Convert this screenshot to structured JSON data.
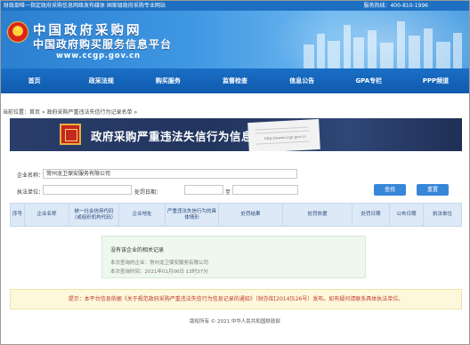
{
  "topbar": {
    "left_text": "财政部唯一指定政府采购信息网络发布媒体 国家级政府采购专业网站",
    "hotline": "服务热线：400-810-1996"
  },
  "header": {
    "site_title": "中国政府采购网",
    "site_subtitle": "中国政府购买服务信息平台",
    "url": "www.ccgp.gov.cn"
  },
  "nav": {
    "items": [
      "首页",
      "政采法规",
      "购买服务",
      "监督检查",
      "信息公告",
      "GPA专栏",
      "PPP频道"
    ]
  },
  "breadcrumb": {
    "prefix": "当前位置：",
    "home": "首页",
    "sep1": " » ",
    "section": "政府采购严重违法失信行为记录名单",
    "sep2": " » "
  },
  "page_title": {
    "text": "政府采购严重违法失信行为信息记录",
    "paper_url": "http://www.ccgp.gov.cn"
  },
  "search": {
    "company_label": "企业名称：",
    "company_value": "常州龙卫保安服务有限公司",
    "dept_label": "执法单位：",
    "dept_value": "",
    "date_label": "处罚日期：",
    "date_sep": "至",
    "date_from": "",
    "date_to": "",
    "search_button": "查找",
    "reset_button": "重置"
  },
  "table": {
    "columns": [
      "序号",
      "企业名称",
      "统一社会信用代码（或组织机构代码）",
      "企业地址",
      "严重违法失信行为的具体情形",
      "处罚结果",
      "处罚依据",
      "处罚日期",
      "公布日期",
      "执法单位"
    ]
  },
  "notice": {
    "title": "没有该企业的相关记录",
    "subject": "本次查询的企业：常州龙卫保安服务有限公司",
    "time": "本次查询时间：2021年01月06日 13时37分"
  },
  "tip": {
    "text": "提示：本平台信息依据《关于规范政府采购严重违法失信行为信息记录的通知》（财办库[2014]526号）发布。如有疑问请联系具体执法单位。"
  },
  "footer": {
    "text": "版权所有 © 2021 中华人民共和国财政部"
  },
  "colors": {
    "nav_blue": "#1a6fc6",
    "title_bar": "#2a3d6b",
    "button_blue": "#3787d8",
    "tip_red": "#c0392b",
    "notice_bg": "#eef8ee"
  }
}
